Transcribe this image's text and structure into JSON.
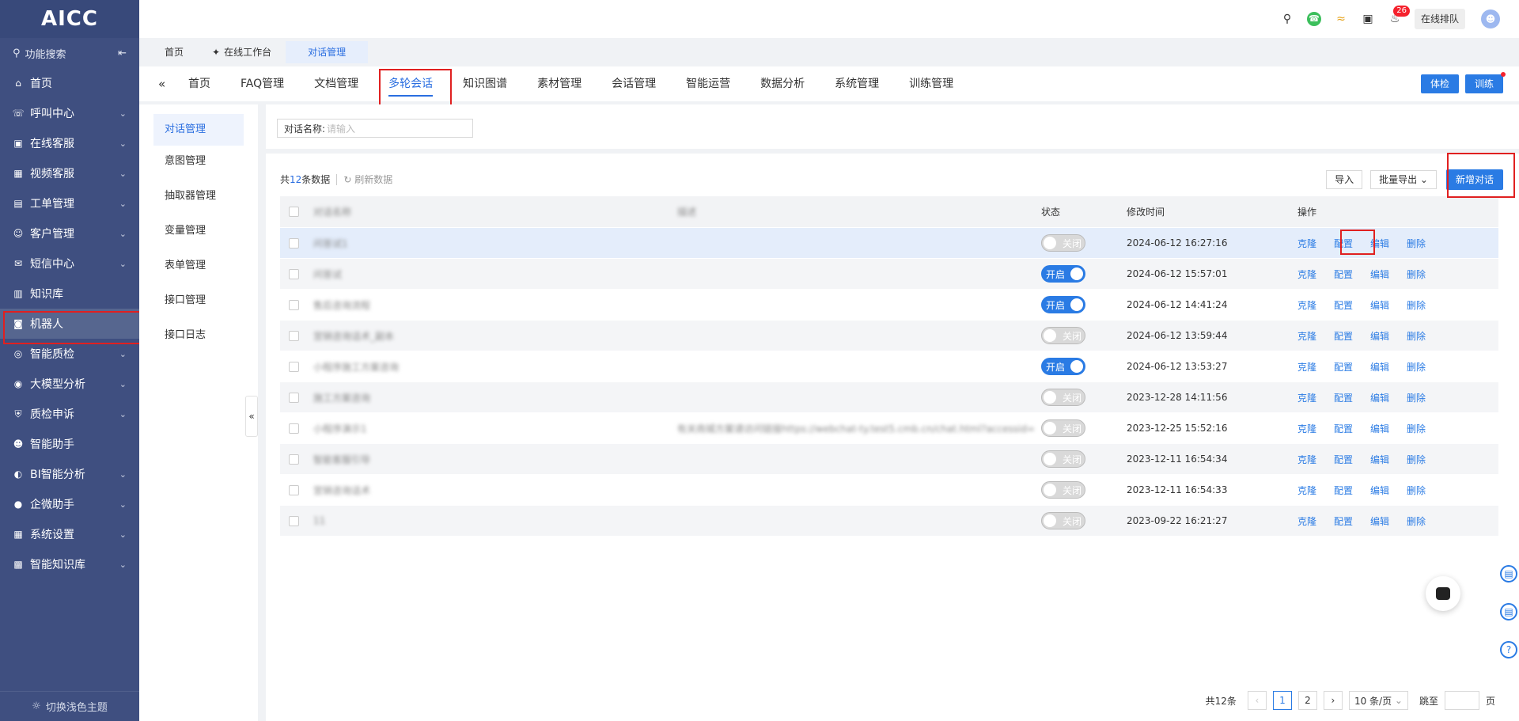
{
  "app": {
    "logo": "AICC",
    "theme_toggle": "切换浅色主题"
  },
  "sidebar": {
    "search_label": "功能搜索",
    "items": [
      {
        "label": "首页",
        "icon": "home-icon",
        "expandable": false
      },
      {
        "label": "呼叫中心",
        "icon": "phone-icon",
        "expandable": true
      },
      {
        "label": "在线客服",
        "icon": "chat-icon",
        "expandable": true
      },
      {
        "label": "视频客服",
        "icon": "grid-icon",
        "expandable": true
      },
      {
        "label": "工单管理",
        "icon": "clipboard-icon",
        "expandable": true
      },
      {
        "label": "客户管理",
        "icon": "users-icon",
        "expandable": true
      },
      {
        "label": "短信中心",
        "icon": "mail-icon",
        "expandable": true
      },
      {
        "label": "知识库",
        "icon": "columns-icon",
        "expandable": false
      },
      {
        "label": "机器人",
        "icon": "robot-icon",
        "expandable": false
      },
      {
        "label": "智能质检",
        "icon": "quality-icon",
        "expandable": true
      },
      {
        "label": "大模型分析",
        "icon": "bubble-icon",
        "expandable": true
      },
      {
        "label": "质检申诉",
        "icon": "shield-icon",
        "expandable": true
      },
      {
        "label": "智能助手",
        "icon": "assistant-icon",
        "expandable": false
      },
      {
        "label": "BI智能分析",
        "icon": "pie-icon",
        "expandable": true
      },
      {
        "label": "企微助手",
        "icon": "wechat-icon",
        "expandable": true
      },
      {
        "label": "系统设置",
        "icon": "settings-grid-icon",
        "expandable": true
      },
      {
        "label": "智能知识库",
        "icon": "apps-icon",
        "expandable": true
      }
    ]
  },
  "topbar": {
    "notification_count": "26",
    "queue_label": "在线排队"
  },
  "page_tabs": [
    "首页",
    "在线工作台",
    "对话管理"
  ],
  "nav": {
    "items": [
      "首页",
      "FAQ管理",
      "文档管理",
      "多轮会话",
      "知识图谱",
      "素材管理",
      "会话管理",
      "智能运营",
      "数据分析",
      "系统管理",
      "训练管理"
    ],
    "check_btn": "体检",
    "train_btn": "训练"
  },
  "subnav": [
    "对话管理",
    "意图管理",
    "抽取器管理",
    "变量管理",
    "表单管理",
    "接口管理",
    "接口日志"
  ],
  "filter": {
    "label": "对话名称:",
    "placeholder": "请输入"
  },
  "list": {
    "total_prefix": "共",
    "total_num": "12",
    "total_suffix": "条数据",
    "refresh": "刷新数据",
    "import_btn": "导入",
    "export_btn": "批量导出",
    "add_btn": "新增对话"
  },
  "table": {
    "headers": [
      "对话名称",
      "描述",
      "状态",
      "修改时间",
      "操作"
    ],
    "rows": [
      {
        "name": "问答试1",
        "desc": "",
        "status": "关闭",
        "on": false,
        "time": "2024-06-12 16:27:16"
      },
      {
        "name": "问答试",
        "desc": "",
        "status": "开启",
        "on": true,
        "time": "2024-06-12 15:57:01"
      },
      {
        "name": "售后咨询流程",
        "desc": "",
        "status": "开启",
        "on": true,
        "time": "2024-06-12 14:41:24"
      },
      {
        "name": "営销咨询话术_副本",
        "desc": "",
        "status": "关闭",
        "on": false,
        "time": "2024-06-12 13:59:44"
      },
      {
        "name": "小程序施工方案咨询",
        "desc": "",
        "status": "开启",
        "on": true,
        "time": "2024-06-12 13:53:27"
      },
      {
        "name": "施工方案咨询",
        "desc": "",
        "status": "关闭",
        "on": false,
        "time": "2023-12-28 14:11:56"
      },
      {
        "name": "小程序演示1",
        "desc": "有关商城方案请访问链接https://webchat-ty.test5.cmb.cn/chat.html?accessid=88f73fba...",
        "status": "关闭",
        "on": false,
        "time": "2023-12-25 15:52:16"
      },
      {
        "name": "智能客服引导",
        "desc": "",
        "status": "关闭",
        "on": false,
        "time": "2023-12-11 16:54:34"
      },
      {
        "name": "営销咨询话术",
        "desc": "",
        "status": "关闭",
        "on": false,
        "time": "2023-12-11 16:54:33"
      },
      {
        "name": "11",
        "desc": "",
        "status": "关闭",
        "on": false,
        "time": "2023-09-22 16:21:27"
      }
    ],
    "ops": [
      "克隆",
      "配置",
      "编辑",
      "删除"
    ]
  },
  "pagination": {
    "total": "共12条",
    "pages": [
      "1",
      "2"
    ],
    "page_size": "10 条/页",
    "jump_label": "跳至",
    "page_suffix": "页"
  }
}
